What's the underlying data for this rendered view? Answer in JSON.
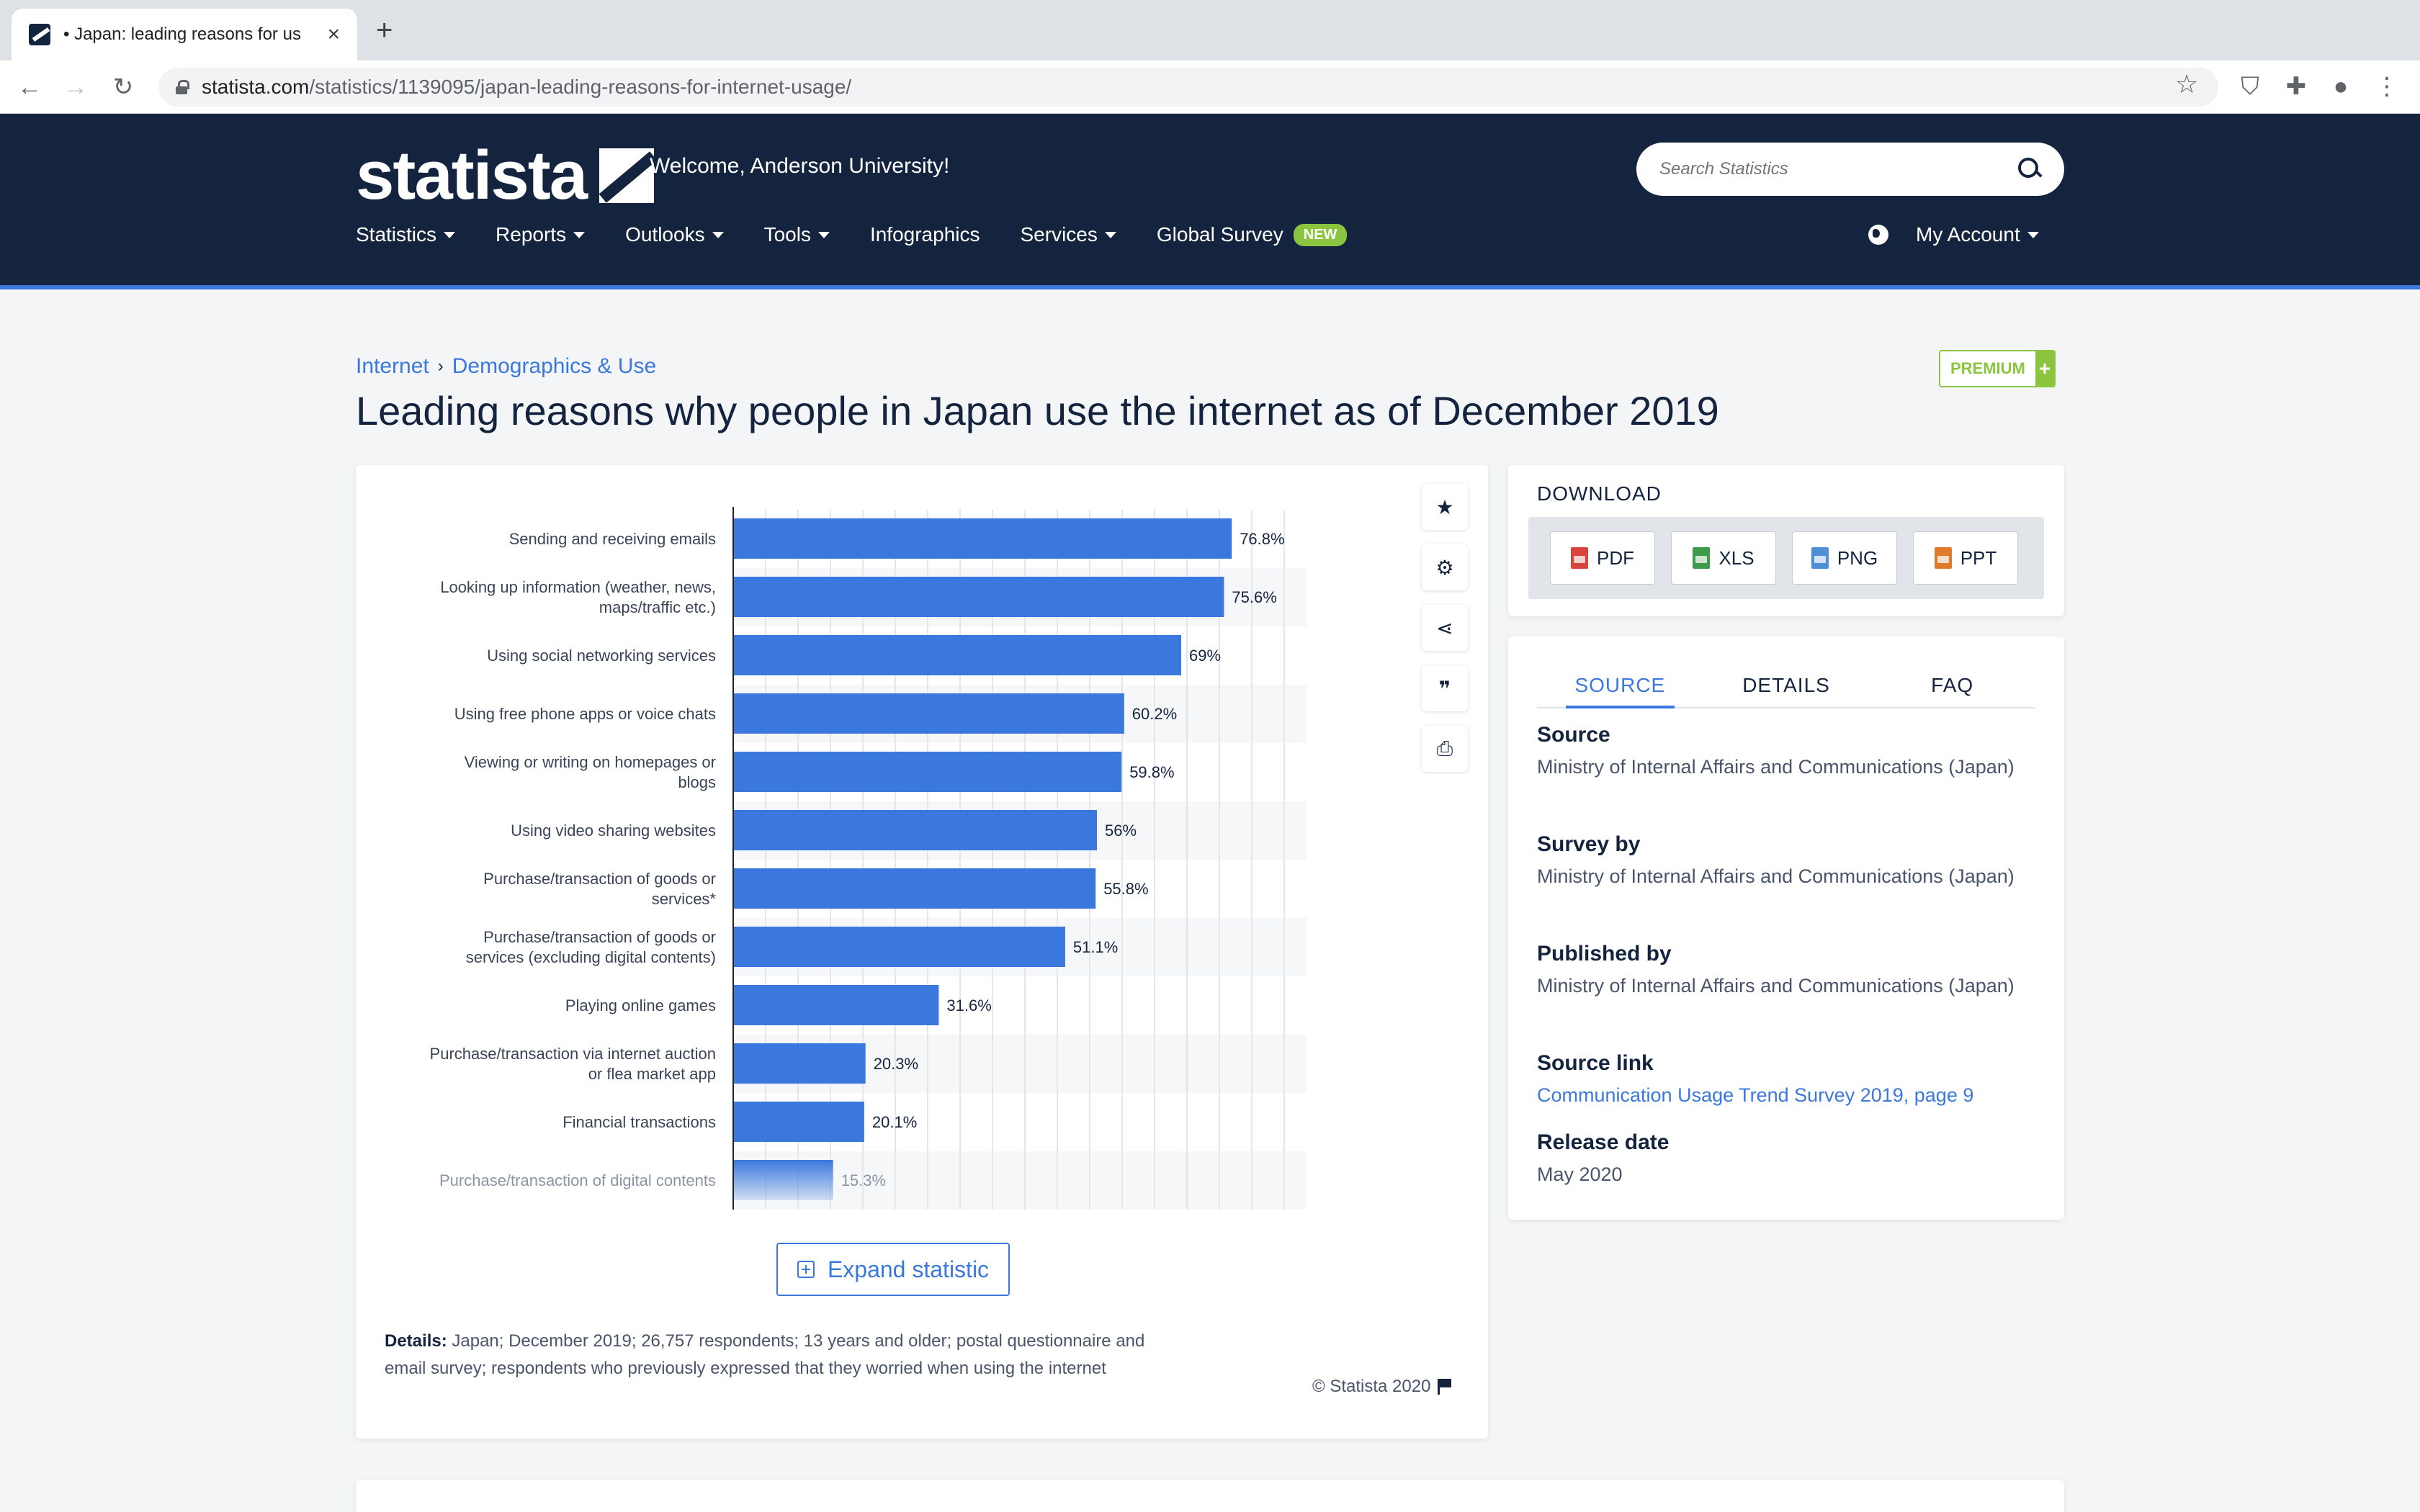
{
  "browser": {
    "tab_title": "• Japan: leading reasons for us",
    "url_host": "statista.com",
    "url_path": "/statistics/1139095/japan-leading-reasons-for-internet-usage/"
  },
  "header": {
    "logo": "statista",
    "welcome": "Welcome, Anderson University!",
    "search_placeholder": "Search Statistics",
    "nav": [
      "Statistics",
      "Reports",
      "Outlooks",
      "Tools",
      "Infographics",
      "Services",
      "Global Survey"
    ],
    "new_badge": "NEW",
    "account": "My Account"
  },
  "breadcrumb": [
    "Internet",
    "Demographics & Use"
  ],
  "premium_label": "PREMIUM",
  "page_title": "Leading reasons why people in Japan use the internet as of December 2019",
  "chart_data": {
    "type": "bar",
    "orientation": "horizontal",
    "categories": [
      [
        "Sending and receiving emails"
      ],
      [
        "Looking up information (weather, news,",
        "maps/traffic etc.)"
      ],
      [
        "Using social networking services"
      ],
      [
        "Using free phone apps or voice chats"
      ],
      [
        "Viewing or writing on homepages or",
        "blogs"
      ],
      [
        "Using video sharing websites"
      ],
      [
        "Purchase/transaction of goods or",
        "services*"
      ],
      [
        "Purchase/transaction of goods or",
        "services (excluding digital contents)"
      ],
      [
        "Playing online games"
      ],
      [
        "Purchase/transaction via internet auction",
        "or flea market app"
      ],
      [
        "Financial transactions"
      ],
      [
        "Purchase/transaction of digital contents"
      ]
    ],
    "values": [
      76.8,
      75.6,
      69,
      60.2,
      59.8,
      56,
      55.8,
      51.1,
      31.6,
      20.3,
      20.1,
      15.3
    ],
    "value_labels": [
      "76.8%",
      "75.6%",
      "69%",
      "60.2%",
      "59.8%",
      "56%",
      "55.8%",
      "51.1%",
      "31.6%",
      "20.3%",
      "20.1%",
      "15.3%"
    ],
    "xlim": [
      0,
      90
    ],
    "grid": true,
    "bar_color": "#3b78dd"
  },
  "expand_label": "Expand statistic",
  "details": {
    "label": "Details:",
    "text": "Japan; December 2019; 26,757 respondents; 13 years and older; postal questionnaire and email survey; respondents who previously expressed that they worried when using the internet"
  },
  "copyright": "© Statista 2020",
  "download": {
    "heading": "DOWNLOAD",
    "buttons": [
      "PDF",
      "XLS",
      "PNG",
      "PPT"
    ]
  },
  "source_tabs": [
    "SOURCE",
    "DETAILS",
    "FAQ"
  ],
  "source": {
    "source_label": "Source",
    "source_value": "Ministry of Internal Affairs and Communications (Japan)",
    "survey_label": "Survey by",
    "survey_value": "Ministry of Internal Affairs and Communications (Japan)",
    "published_label": "Published by",
    "published_value": "Ministry of Internal Affairs and Communications (Japan)",
    "link_label": "Source link",
    "link_value": "Communication Usage Trend Survey 2019, page 9",
    "release_label": "Release date",
    "release_value": "May 2020"
  },
  "colors": {
    "navy": "#14243f",
    "accent": "#3b78dd",
    "premium_green": "#8bc53f"
  }
}
